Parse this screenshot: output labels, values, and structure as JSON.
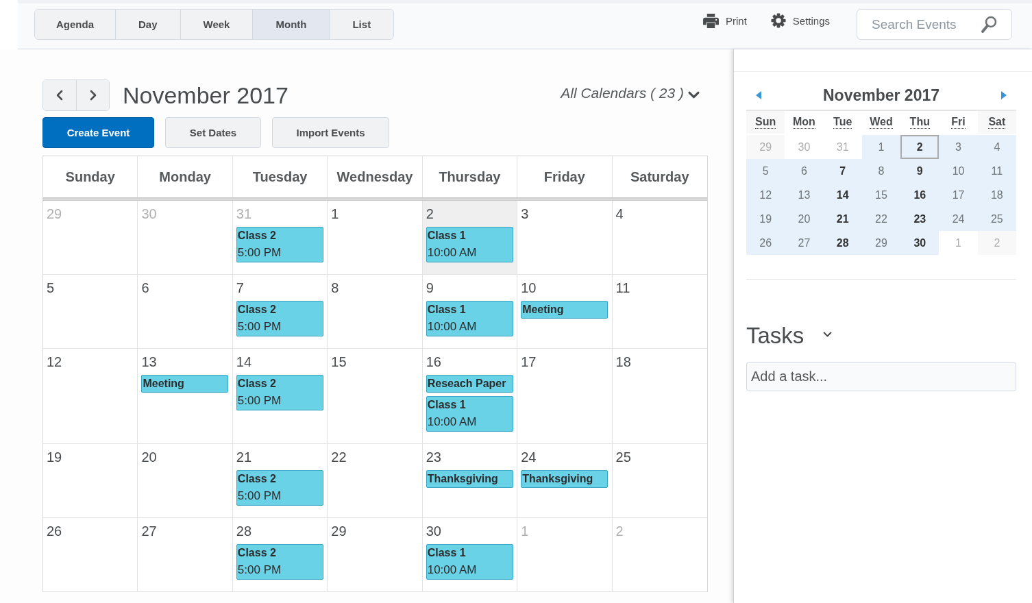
{
  "view_tabs": [
    {
      "label": "Agenda",
      "selected": false
    },
    {
      "label": "Day",
      "selected": false
    },
    {
      "label": "Week",
      "selected": false
    },
    {
      "label": "Month",
      "selected": true
    },
    {
      "label": "List",
      "selected": false
    }
  ],
  "toolbar": {
    "print": "Print",
    "settings": "Settings",
    "search": {
      "placeholder": "Search Events"
    }
  },
  "calendar": {
    "title": "November 2017",
    "calendars_filter": "All Calendars ( 23 )",
    "actions": [
      {
        "label": "Create Event",
        "kind": "primary"
      },
      {
        "label": "Set Dates",
        "kind": "secondary"
      },
      {
        "label": "Import Events",
        "kind": "secondary"
      }
    ],
    "weekdays": [
      "Sunday",
      "Monday",
      "Tuesday",
      "Wednesday",
      "Thursday",
      "Friday",
      "Saturday"
    ],
    "weeks": [
      [
        {
          "day": "29",
          "other_month": true,
          "today": false
        },
        {
          "day": "30",
          "other_month": true,
          "today": false
        },
        {
          "day": "31",
          "other_month": true,
          "today": false,
          "events": [
            {
              "title": "Class 2",
              "time": "5:00 PM"
            }
          ]
        },
        {
          "day": "1",
          "other_month": false,
          "today": false
        },
        {
          "day": "2",
          "other_month": false,
          "today": true,
          "events": [
            {
              "title": "Class 1",
              "time": "10:00 AM"
            }
          ]
        },
        {
          "day": "3",
          "other_month": false,
          "today": false
        },
        {
          "day": "4",
          "other_month": false,
          "today": false
        }
      ],
      [
        {
          "day": "5",
          "other_month": false,
          "today": false
        },
        {
          "day": "6",
          "other_month": false,
          "today": false
        },
        {
          "day": "7",
          "other_month": false,
          "today": false,
          "events": [
            {
              "title": "Class 2",
              "time": "5:00 PM"
            }
          ]
        },
        {
          "day": "8",
          "other_month": false,
          "today": false
        },
        {
          "day": "9",
          "other_month": false,
          "today": false,
          "events": [
            {
              "title": "Class 1",
              "time": "10:00 AM"
            }
          ]
        },
        {
          "day": "10",
          "other_month": false,
          "today": false,
          "events": [
            {
              "title": "Meeting"
            }
          ]
        },
        {
          "day": "11",
          "other_month": false,
          "today": false
        }
      ],
      [
        {
          "day": "12",
          "other_month": false,
          "today": false
        },
        {
          "day": "13",
          "other_month": false,
          "today": false,
          "events": [
            {
              "title": "Meeting"
            }
          ]
        },
        {
          "day": "14",
          "other_month": false,
          "today": false,
          "events": [
            {
              "title": "Class 2",
              "time": "5:00 PM"
            }
          ]
        },
        {
          "day": "15",
          "other_month": false,
          "today": false
        },
        {
          "day": "16",
          "other_month": false,
          "today": false,
          "events": [
            {
              "title": "Reseach Paper"
            },
            {
              "title": "Class 1",
              "time": "10:00 AM"
            }
          ]
        },
        {
          "day": "17",
          "other_month": false,
          "today": false
        },
        {
          "day": "18",
          "other_month": false,
          "today": false
        }
      ],
      [
        {
          "day": "19",
          "other_month": false,
          "today": false
        },
        {
          "day": "20",
          "other_month": false,
          "today": false
        },
        {
          "day": "21",
          "other_month": false,
          "today": false,
          "events": [
            {
              "title": "Class 2",
              "time": "5:00 PM"
            }
          ]
        },
        {
          "day": "22",
          "other_month": false,
          "today": false
        },
        {
          "day": "23",
          "other_month": false,
          "today": false,
          "events": [
            {
              "title": "Thanksgiving"
            }
          ]
        },
        {
          "day": "24",
          "other_month": false,
          "today": false,
          "events": [
            {
              "title": "Thanksgiving"
            }
          ]
        },
        {
          "day": "25",
          "other_month": false,
          "today": false
        }
      ],
      [
        {
          "day": "26",
          "other_month": false,
          "today": false
        },
        {
          "day": "27",
          "other_month": false,
          "today": false
        },
        {
          "day": "28",
          "other_month": false,
          "today": false,
          "events": [
            {
              "title": "Class 2",
              "time": "5:00 PM"
            }
          ]
        },
        {
          "day": "29",
          "other_month": false,
          "today": false
        },
        {
          "day": "30",
          "other_month": false,
          "today": false,
          "events": [
            {
              "title": "Class 1",
              "time": "10:00 AM"
            }
          ]
        },
        {
          "day": "1",
          "other_month": true,
          "today": false
        },
        {
          "day": "2",
          "other_month": true,
          "today": false
        }
      ]
    ]
  },
  "mini_calendar": {
    "title": "November 2017",
    "weekdays": [
      "Sun",
      "Mon",
      "Tue",
      "Wed",
      "Thu",
      "Fri",
      "Sat"
    ],
    "weeks": [
      [
        {
          "day": "29",
          "other_month": true,
          "bold": false,
          "today": false
        },
        {
          "day": "30",
          "other_month": true,
          "bold": false,
          "today": false
        },
        {
          "day": "31",
          "other_month": true,
          "bold": false,
          "today": false
        },
        {
          "day": "1",
          "other_month": false,
          "bold": false,
          "today": false
        },
        {
          "day": "2",
          "other_month": false,
          "bold": true,
          "today": true
        },
        {
          "day": "3",
          "other_month": false,
          "bold": false,
          "today": false
        },
        {
          "day": "4",
          "other_month": false,
          "bold": false,
          "today": false
        }
      ],
      [
        {
          "day": "5",
          "other_month": false,
          "bold": false,
          "today": false
        },
        {
          "day": "6",
          "other_month": false,
          "bold": false,
          "today": false
        },
        {
          "day": "7",
          "other_month": false,
          "bold": true,
          "today": false
        },
        {
          "day": "8",
          "other_month": false,
          "bold": false,
          "today": false
        },
        {
          "day": "9",
          "other_month": false,
          "bold": true,
          "today": false
        },
        {
          "day": "10",
          "other_month": false,
          "bold": false,
          "today": false
        },
        {
          "day": "11",
          "other_month": false,
          "bold": false,
          "today": false
        }
      ],
      [
        {
          "day": "12",
          "other_month": false,
          "bold": false,
          "today": false
        },
        {
          "day": "13",
          "other_month": false,
          "bold": false,
          "today": false
        },
        {
          "day": "14",
          "other_month": false,
          "bold": true,
          "today": false
        },
        {
          "day": "15",
          "other_month": false,
          "bold": false,
          "today": false
        },
        {
          "day": "16",
          "other_month": false,
          "bold": true,
          "today": false
        },
        {
          "day": "17",
          "other_month": false,
          "bold": false,
          "today": false
        },
        {
          "day": "18",
          "other_month": false,
          "bold": false,
          "today": false
        }
      ],
      [
        {
          "day": "19",
          "other_month": false,
          "bold": false,
          "today": false
        },
        {
          "day": "20",
          "other_month": false,
          "bold": false,
          "today": false
        },
        {
          "day": "21",
          "other_month": false,
          "bold": true,
          "today": false
        },
        {
          "day": "22",
          "other_month": false,
          "bold": false,
          "today": false
        },
        {
          "day": "23",
          "other_month": false,
          "bold": true,
          "today": false
        },
        {
          "day": "24",
          "other_month": false,
          "bold": false,
          "today": false
        },
        {
          "day": "25",
          "other_month": false,
          "bold": false,
          "today": false
        }
      ],
      [
        {
          "day": "26",
          "other_month": false,
          "bold": false,
          "today": false
        },
        {
          "day": "27",
          "other_month": false,
          "bold": false,
          "today": false
        },
        {
          "day": "28",
          "other_month": false,
          "bold": true,
          "today": false
        },
        {
          "day": "29",
          "other_month": false,
          "bold": false,
          "today": false
        },
        {
          "day": "30",
          "other_month": false,
          "bold": true,
          "today": false
        },
        {
          "day": "1",
          "other_month": true,
          "bold": false,
          "today": false
        },
        {
          "day": "2",
          "other_month": true,
          "bold": false,
          "today": false
        }
      ]
    ]
  },
  "tasks": {
    "title": "Tasks",
    "input": {
      "placeholder": "Add a task..."
    }
  }
}
